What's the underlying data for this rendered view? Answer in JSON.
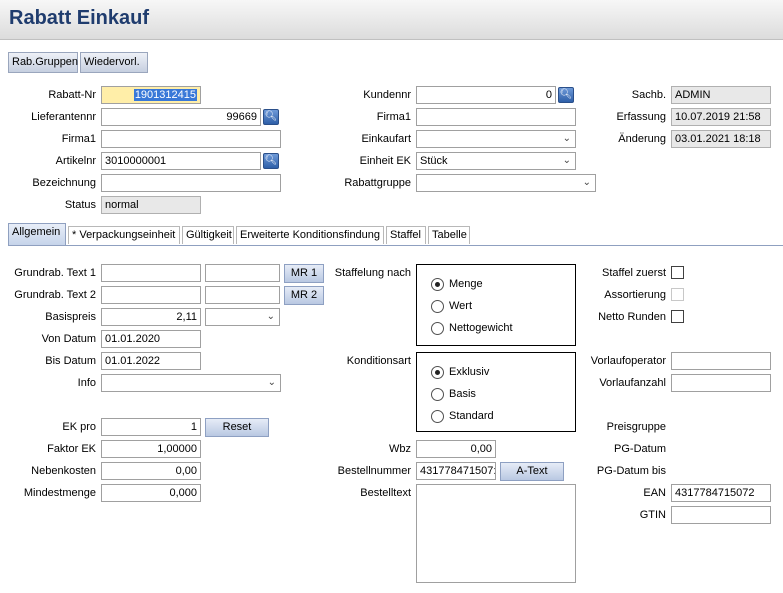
{
  "title": "Rabatt Einkauf",
  "toolbar": {
    "rab_gruppen": "Rab.Gruppen",
    "wiedervorl": "Wiedervorl."
  },
  "header": {
    "rabatt_nr_label": "Rabatt-Nr",
    "rabatt_nr_value": "1901312415",
    "lieferantennr_label": "Lieferantennr",
    "lieferantennr_value": "99669",
    "firma1_label": "Firma1",
    "firma1_value": "",
    "artikelnr_label": "Artikelnr",
    "artikelnr_value": "3010000001",
    "bezeichnung_label": "Bezeichnung",
    "bezeichnung_value": "",
    "status_label": "Status",
    "status_value": "normal",
    "kundennr_label": "Kundennr",
    "kundennr_value": "0",
    "firma1b_label": "Firma1",
    "firma1b_value": "",
    "einkaufart_label": "Einkaufart",
    "einkaufart_value": "",
    "einheit_ek_label": "Einheit EK",
    "einheit_ek_value": "Stück",
    "rabattgruppe_label": "Rabattgruppe",
    "rabattgruppe_value": "",
    "sachb_label": "Sachb.",
    "sachb_value": "ADMIN",
    "erfassung_label": "Erfassung",
    "erfassung_value": "10.07.2019 21:58",
    "aenderung_label": "Änderung",
    "aenderung_value": "03.01.2021 18:18"
  },
  "tabs": [
    "Allgemein",
    "* Verpackungseinheit",
    "Gültigkeit",
    "Erweiterte Konditionsfindung",
    "Staffel",
    "Tabelle"
  ],
  "left": {
    "grundrab1_label": "Grundrab. Text 1",
    "grundrab1_value": "",
    "grundrab1_value2": "",
    "mr1": "MR 1",
    "grundrab2_label": "Grundrab. Text 2",
    "grundrab2_value": "",
    "grundrab2_value2": "",
    "mr2": "MR 2",
    "basispreis_label": "Basispreis",
    "basispreis_value": "2,11",
    "basispreis_unit": "",
    "von_datum_label": "Von Datum",
    "von_datum_value": "01.01.2020",
    "bis_datum_label": "Bis Datum",
    "bis_datum_value": "01.01.2022",
    "info_label": "Info",
    "info_value": "",
    "ek_pro_label": "EK pro",
    "ek_pro_value": "1",
    "reset": "Reset",
    "faktor_ek_label": "Faktor EK",
    "faktor_ek_value": "1,00000",
    "nebenkosten_label": "Nebenkosten",
    "nebenkosten_value": "0,00",
    "mindestmenge_label": "Mindestmenge",
    "mindestmenge_value": "0,000"
  },
  "middle": {
    "staffelung_label": "Staffelung nach",
    "staffelung_options": [
      "Menge",
      "Wert",
      "Nettogewicht"
    ],
    "konditionsart_label": "Konditionsart",
    "konditionsart_options": [
      "Exklusiv",
      "Basis",
      "Standard"
    ],
    "wbz_label": "Wbz",
    "wbz_value": "0,00",
    "bestellnummer_label": "Bestellnummer",
    "bestellnummer_value": "431778471507:",
    "a_text": "A-Text",
    "bestelltext_label": "Bestelltext",
    "bestelltext_value": ""
  },
  "right": {
    "staffel_zuerst_label": "Staffel zuerst",
    "assortierung_label": "Assortierung",
    "netto_runden_label": "Netto Runden",
    "vorlaufoperator_label": "Vorlaufoperator",
    "vorlaufoperator_value": "",
    "vorlaufanzahl_label": "Vorlaufanzahl",
    "vorlaufanzahl_value": "",
    "preisgruppe_label": "Preisgruppe",
    "pg_datum_label": "PG-Datum",
    "pg_datum_bis_label": "PG-Datum bis",
    "ean_label": "EAN",
    "ean_value": "4317784715072",
    "gtin_label": "GTIN",
    "gtin_value": ""
  },
  "icons": {
    "search": "magnifier-icon",
    "dropdown": "chevron-down-icon"
  },
  "colors": {
    "title": "#1f3c6e",
    "selection": "#3878d8",
    "accent_button": "#b9c8e2"
  }
}
